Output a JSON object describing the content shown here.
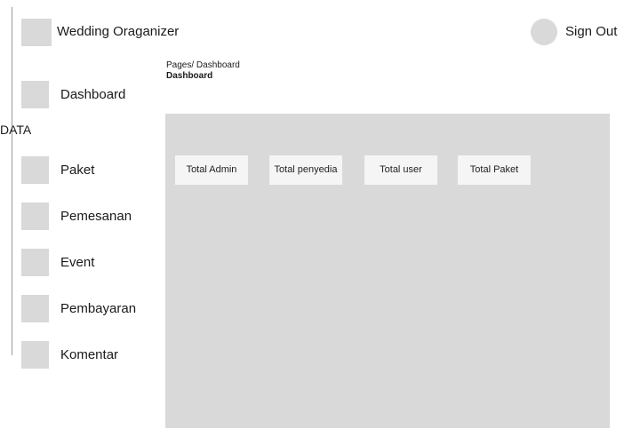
{
  "header": {
    "app_title": "Wedding Oraganizer",
    "signout_label": "Sign Out"
  },
  "breadcrumb": {
    "path": "Pages/ Dashboard",
    "title": "Dashboard"
  },
  "sidebar": {
    "items": [
      {
        "label": "Dashboard"
      },
      {
        "label": "Paket"
      },
      {
        "label": "Pemesanan"
      },
      {
        "label": "Event"
      },
      {
        "label": "Pembayaran"
      },
      {
        "label": "Komentar"
      }
    ],
    "section_label": "DATA"
  },
  "stats": [
    {
      "label": "Total Admin"
    },
    {
      "label": "Total penyedia"
    },
    {
      "label": "Total user"
    },
    {
      "label": "Total Paket"
    }
  ],
  "colors": {
    "placeholder_gray": "#d9d9d9",
    "card_bg": "#f5f5f5"
  },
  "icons": {
    "logo": "logo-placeholder-icon",
    "avatar": "avatar-icon",
    "nav": "nav-placeholder-icon"
  }
}
